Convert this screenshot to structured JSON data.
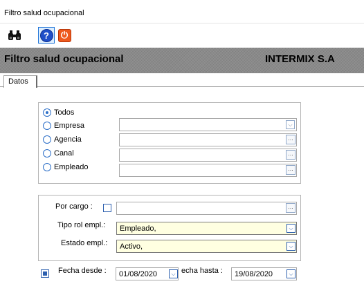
{
  "window": {
    "title": "Filtro salud ocupacional"
  },
  "toolbar": {
    "buttons": [
      {
        "name": "binoculars-icon",
        "label": ""
      },
      {
        "name": "help-icon",
        "label": "?"
      },
      {
        "name": "power-icon",
        "label": "⏻"
      }
    ]
  },
  "header": {
    "title": "Filtro salud ocupacional",
    "company": "INTERMIX S.A"
  },
  "tabs": [
    {
      "label": "Datos"
    }
  ],
  "filter_scope": {
    "options": [
      {
        "label": "Todos",
        "checked": true
      },
      {
        "label": "Empresa",
        "checked": false,
        "value": "",
        "control": "dropdown"
      },
      {
        "label": "Agencia",
        "checked": false,
        "value": "",
        "control": "ellipsis"
      },
      {
        "label": "Canal",
        "checked": false,
        "value": "",
        "control": "ellipsis"
      },
      {
        "label": "Empleado",
        "checked": false,
        "value": "",
        "control": "ellipsis"
      }
    ]
  },
  "filters": {
    "por_cargo_label": "Por cargo :",
    "por_cargo_value": "",
    "tipo_rol_label": "Tipo rol empl.:",
    "tipo_rol_value": "Empleado,",
    "estado_label": "Estado empl.:",
    "estado_value": "Activo,"
  },
  "dates": {
    "fecha_desde_label": "Fecha desde :",
    "fecha_desde_value": "01/08/2020",
    "fecha_hasta_label": "echa hasta :",
    "fecha_hasta_value": "19/08/2020"
  },
  "glyphs": {
    "dropdown": "⌵",
    "ellipsis": "..."
  },
  "colors": {
    "accent": "#2c5fae",
    "header_band": "#8a8a8a",
    "field_highlight": "#ffffe1"
  }
}
